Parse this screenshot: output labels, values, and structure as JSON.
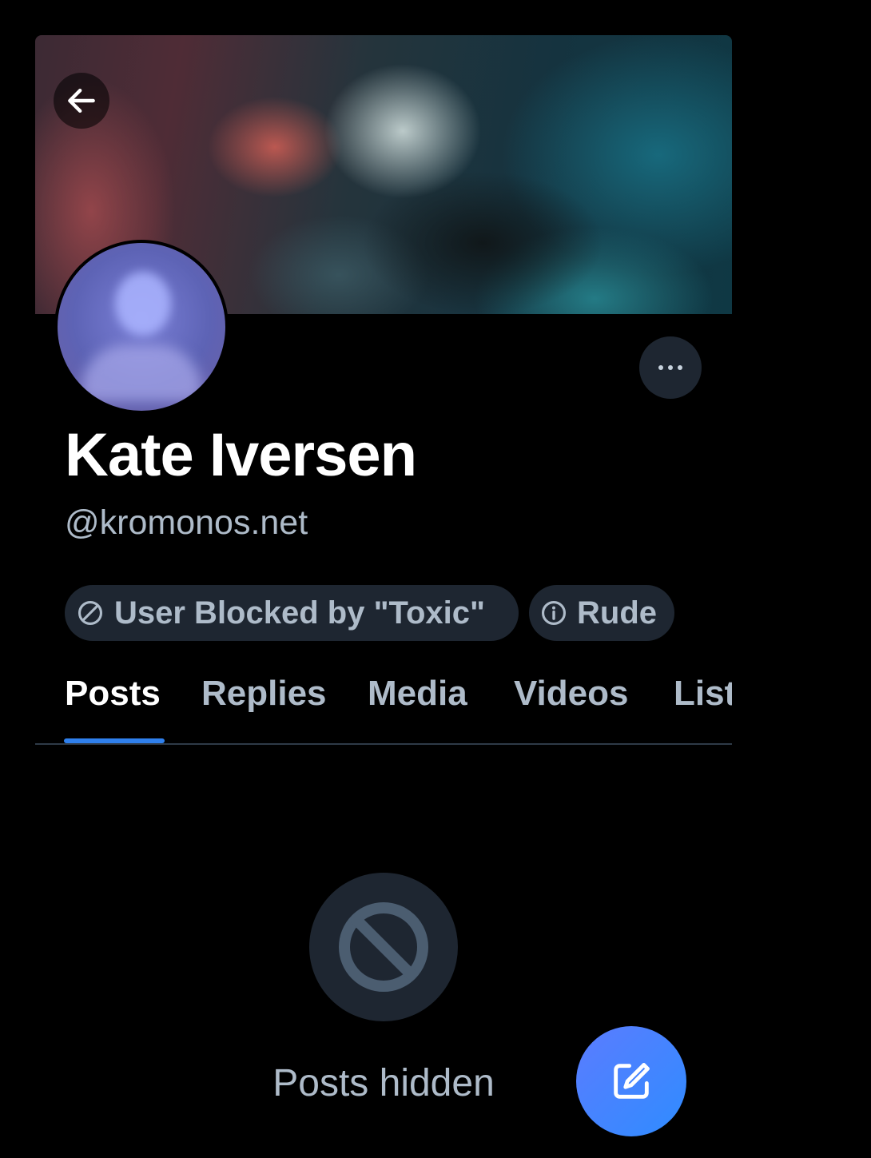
{
  "profile": {
    "display_name": "Kate Iversen",
    "handle": "@kromonos.net"
  },
  "labels": [
    {
      "text": "User Blocked by \"Toxic\"",
      "icon": "block-icon"
    },
    {
      "text": "Rude",
      "icon": "info-icon"
    }
  ],
  "tabs": [
    {
      "label": "Posts",
      "active": true
    },
    {
      "label": "Replies",
      "active": false
    },
    {
      "label": "Media",
      "active": false
    },
    {
      "label": "Videos",
      "active": false
    },
    {
      "label": "Lists",
      "active": false
    }
  ],
  "empty_state": {
    "text": "Posts hidden",
    "icon": "prohibited-icon"
  },
  "icons": {
    "back": "arrow-left-icon",
    "more": "ellipsis-icon",
    "compose": "compose-icon"
  },
  "colors": {
    "background": "#000000",
    "pill_background": "#1e2631",
    "muted_text": "#aebbc9",
    "accent": "#2f80ed",
    "fab": "#3d86ff"
  }
}
